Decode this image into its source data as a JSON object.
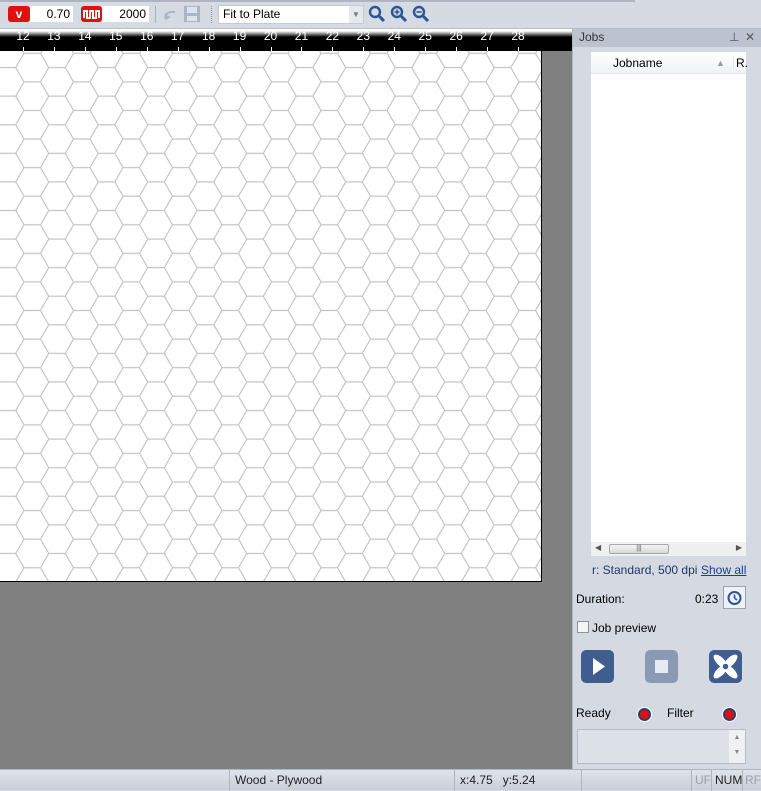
{
  "toolbar": {
    "speed_icon_label": "v",
    "speed_value": "0.70",
    "frequency_value": "2000",
    "zoom_mode": "Fit to Plate"
  },
  "ruler": {
    "ticks": [
      "12",
      "13",
      "14",
      "15",
      "16",
      "17",
      "18",
      "19",
      "20",
      "21",
      "22",
      "23",
      "24",
      "25",
      "26",
      "27",
      "28"
    ]
  },
  "panel": {
    "title": "Jobs",
    "columns": {
      "jobname": "Jobname",
      "r": "R."
    },
    "settings_text": "r: Standard, 500 dpi",
    "show_all": "Show all",
    "duration_label": "Duration:",
    "duration_value": "0:23",
    "job_preview_label": "Job preview",
    "job_preview_checked": false,
    "ready_label": "Ready",
    "filter_label": "Filter",
    "ready_status_color": "#e01010",
    "filter_status_color": "#e01010"
  },
  "status": {
    "material": "Wood - Plywood",
    "coords": "x:4.75   y:5.24",
    "uf": "UF",
    "num": "NUM",
    "rf": "RF"
  }
}
